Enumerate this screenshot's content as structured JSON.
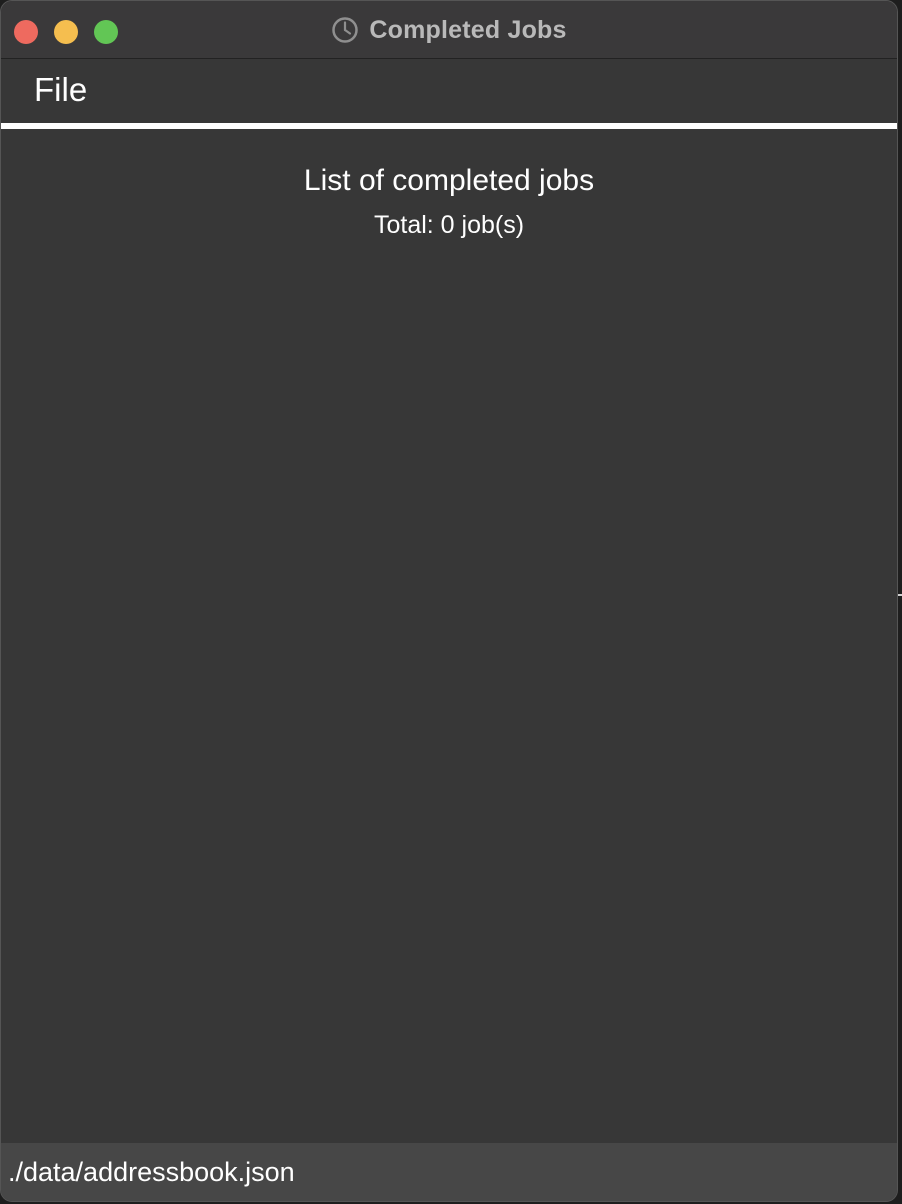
{
  "window": {
    "title": "Completed Jobs",
    "title_icon": "clock-icon"
  },
  "menubar": {
    "items": [
      {
        "label": "File"
      }
    ]
  },
  "main": {
    "heading": "List of completed jobs",
    "total": "Total: 0 job(s)"
  },
  "statusbar": {
    "path": "./data/addressbook.json"
  },
  "colors": {
    "close": "#ee6a5f",
    "minimize": "#f5be4f",
    "zoom": "#62c655",
    "background": "#373737",
    "statusbar": "#474747"
  }
}
